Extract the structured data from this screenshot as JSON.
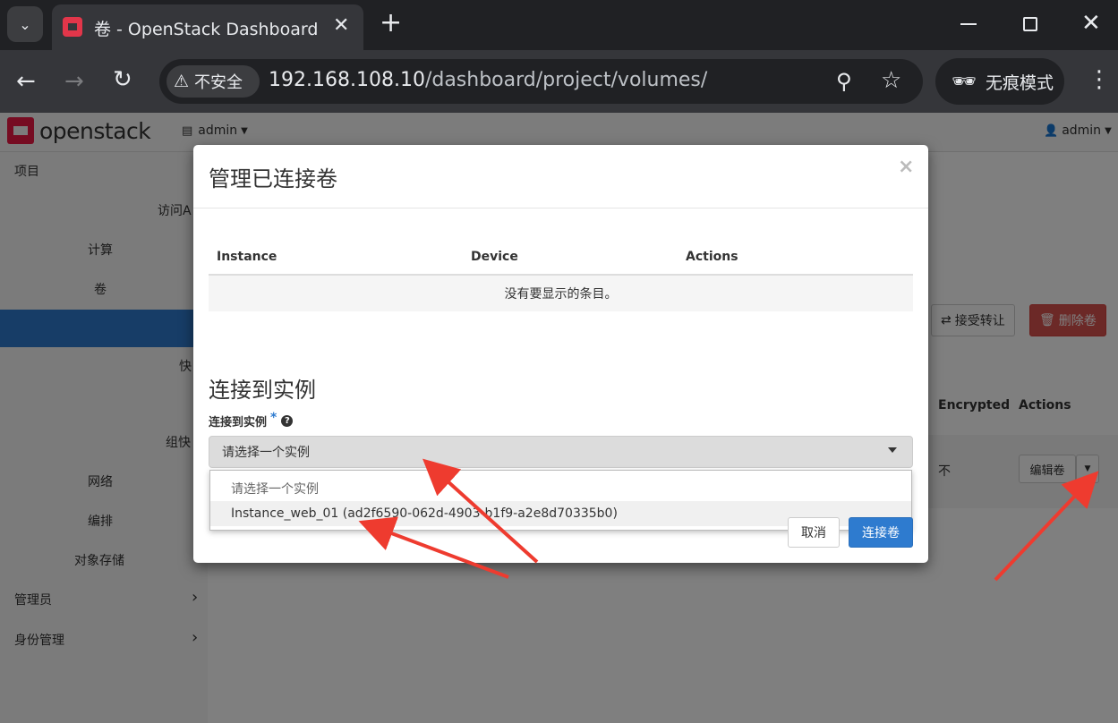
{
  "browser": {
    "tab_title": "卷 - OpenStack Dashboard",
    "security_label": "不安全",
    "url_host": "192.168.108.10",
    "url_path": "/dashboard/project/volumes/",
    "incognito_label": "无痕模式"
  },
  "app": {
    "brand": "openstack",
    "project_label": "admin",
    "user_label": "admin"
  },
  "sidebar": {
    "items": [
      {
        "label": "项目"
      },
      {
        "label": "访问A"
      },
      {
        "label": "计算"
      },
      {
        "label": "卷"
      },
      {
        "label": "快"
      },
      {
        "label": "组快"
      },
      {
        "label": "网络"
      },
      {
        "label": "编排"
      },
      {
        "label": "对象存储"
      },
      {
        "label": "管理员"
      },
      {
        "label": "身份管理"
      }
    ]
  },
  "content": {
    "accept_transfer": "接受转让",
    "delete_volumes": "删除卷",
    "col_encrypted": "Encrypted",
    "col_actions": "Actions",
    "row_encrypted": "不",
    "row_edit": "编辑卷"
  },
  "modal": {
    "title": "管理已连接卷",
    "table": {
      "headers": [
        "Instance",
        "Device",
        "Actions"
      ],
      "empty_text": "没有要显示的条目。"
    },
    "attach_section_title": "连接到实例",
    "field_label": "连接到实例",
    "required_mark": "*",
    "select_value": "请选择一个实例",
    "options": [
      "请选择一个实例",
      "Instance_web_01 (ad2f6590-062d-4903-b1f9-a2e8d70335b0)"
    ],
    "cancel_label": "取消",
    "submit_label": "连接卷"
  },
  "colors": {
    "brand_red": "#ed1944",
    "primary_blue": "#2e7bcf",
    "danger_red": "#d9534f",
    "annotation_arrow": "#ee3b2f"
  }
}
